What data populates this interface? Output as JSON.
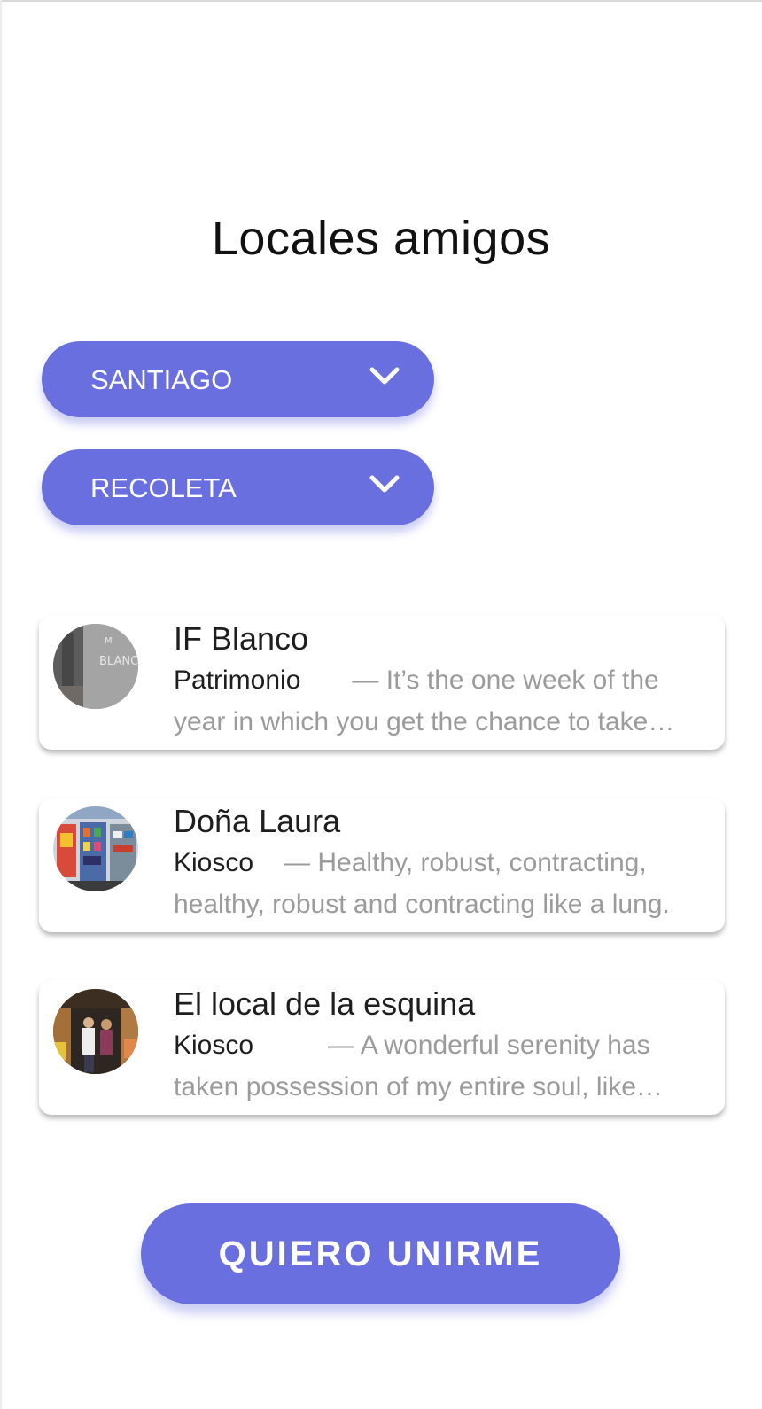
{
  "page": {
    "title": "Locales amigos",
    "accent_color": "#6a6fe0"
  },
  "filters": {
    "city": {
      "value": "SANTIAGO",
      "icon": "chevron-down-icon"
    },
    "district": {
      "value": "RECOLETA",
      "icon": "chevron-down-icon"
    }
  },
  "stores": [
    {
      "name": "IF Blanco",
      "category": "Patrimonio",
      "line1": "— It’s the one week of the",
      "line2": "year in which you get the chance to take…",
      "image": "storefront-photo"
    },
    {
      "name": "Doña Laura",
      "category": "Kiosco",
      "line1": "— Healthy, robust, contracting,",
      "line2": "healthy, robust and contracting like a lung.",
      "image": "kiosk-photo"
    },
    {
      "name": "El local de la esquina",
      "category": "Kiosco",
      "line1": "— A wonderful serenity has",
      "line2": "taken possession of my entire soul, like…",
      "image": "corner-shop-photo"
    }
  ],
  "cta": {
    "label": "QUIERO UNIRME"
  }
}
